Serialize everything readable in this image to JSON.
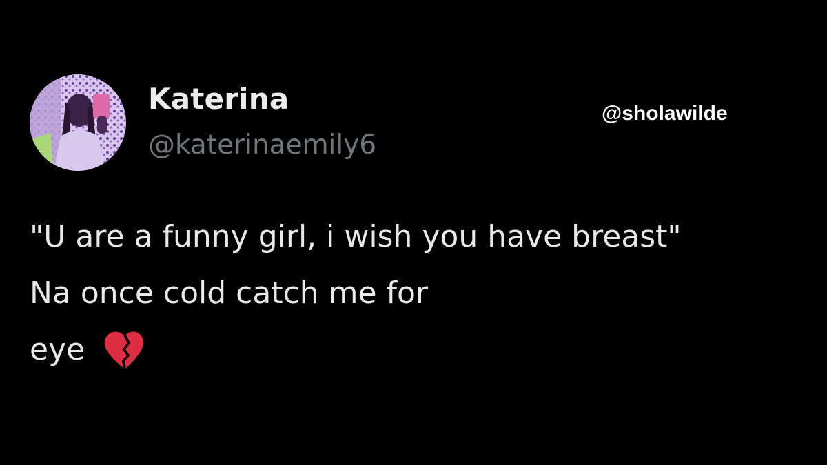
{
  "tweet": {
    "display_name": "Katerina",
    "handle": "@katerinaemily6",
    "avatar_icon": "profile-photo-avatar",
    "lines": [
      "\"U are a funny girl, i wish you have breast\"",
      "Na once cold catch me for",
      "eye"
    ],
    "emoji": "broken-heart-icon"
  },
  "watermark": "@sholawilde",
  "colors": {
    "background": "#000000",
    "text_primary": "#e7e9ea",
    "text_secondary": "#71767b",
    "emoji": "#dd2e44",
    "avatar_tint": "#8a5fb8"
  }
}
